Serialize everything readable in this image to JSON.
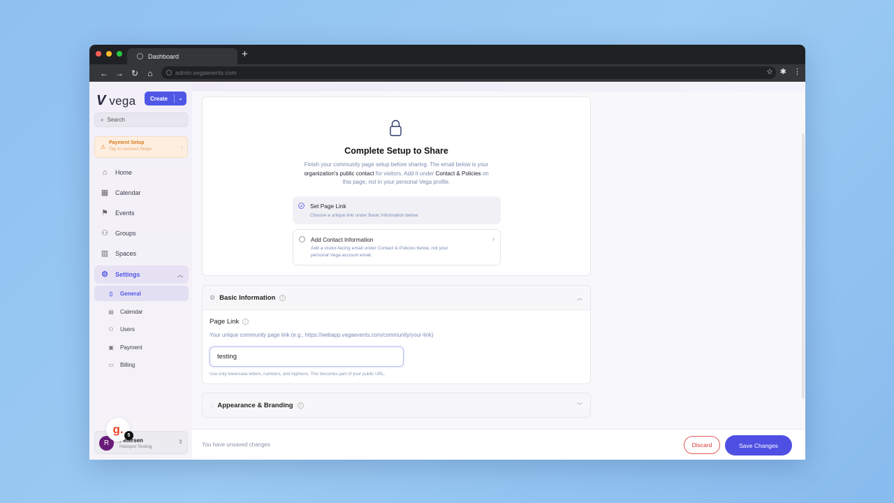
{
  "browser": {
    "tab_title": "Dashboard",
    "url": "admin.vegaevents.com",
    "traffic_colors": [
      "#ff5f57",
      "#febc2e",
      "#28c840"
    ]
  },
  "sidebar": {
    "logo_text": "vega",
    "create_label": "Create",
    "search_placeholder": "Search",
    "payment_banner": {
      "title": "Payment Setup",
      "subtitle": "Tap to connect Stripe"
    },
    "nav": [
      {
        "label": "Home",
        "icon": "home-icon"
      },
      {
        "label": "Calendar",
        "icon": "calendar-icon"
      },
      {
        "label": "Events",
        "icon": "flag-icon"
      },
      {
        "label": "Groups",
        "icon": "groups-icon"
      },
      {
        "label": "Spaces",
        "icon": "building-icon"
      },
      {
        "label": "Settings",
        "icon": "gear-icon"
      }
    ],
    "settings_sub": [
      {
        "label": "General",
        "icon": "document-icon"
      },
      {
        "label": "Calendar",
        "icon": "calendar-icon"
      },
      {
        "label": "Users",
        "icon": "users-icon"
      },
      {
        "label": "Payment",
        "icon": "payment-icon"
      },
      {
        "label": "Billing",
        "icon": "billing-icon"
      }
    ],
    "user": {
      "initial": "R",
      "name": "Petersen",
      "org": "Hubspot Testing"
    },
    "badge": {
      "letter": "g.",
      "count": "5"
    }
  },
  "setup": {
    "title": "Complete Setup to Share",
    "desc_1": "Finish your community page setup before sharing. The email below is your",
    "desc_2_strong": "organization's public contact",
    "desc_2_rest": " for visitors. Add it under ",
    "desc_2_link": "Contact & Policies",
    "desc_2_end": " on",
    "desc_3": "this page, not in your personal Vega profile.",
    "steps": [
      {
        "title": "Set Page Link",
        "desc": "Choose a unique link under Basic Information below."
      },
      {
        "title": "Add Contact Information",
        "desc_1": "Add a visitor-facing email under Contact & Policies below, not your",
        "desc_2": "personal Vega account email."
      }
    ]
  },
  "basic_info": {
    "header": "Basic Information",
    "field_label": "Page Link",
    "field_help": "Your unique community page link (e.g., https://webapp.vegaevents.com/community/your-link)",
    "field_value": "testing",
    "field_note": "Use only lowercase letters, numbers, and hyphens. This becomes part of your public URL."
  },
  "appearance": {
    "header": "Appearance & Branding"
  },
  "footer": {
    "unsaved_text": "You have unsaved changes",
    "discard_label": "Discard",
    "save_label": "Save Changes"
  },
  "colors": {
    "accent": "#4f56e6",
    "danger": "#d9383a",
    "warning": "#d97b1f"
  }
}
